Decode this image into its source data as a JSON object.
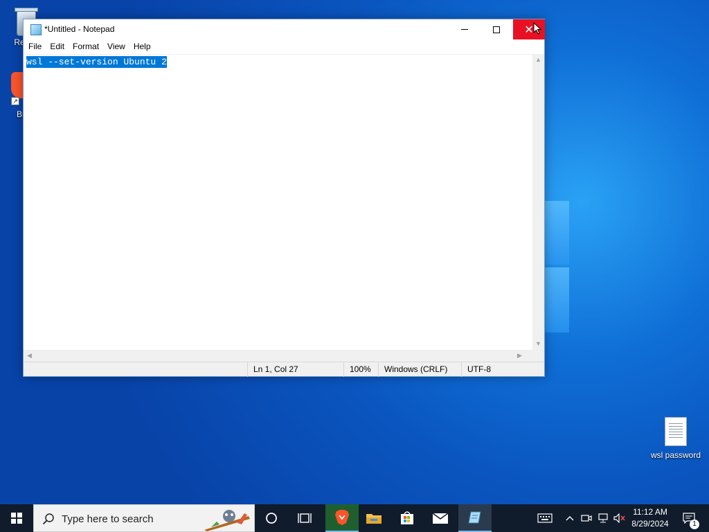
{
  "desktop": {
    "icons": [
      {
        "label": "Recyc"
      },
      {
        "label": "Br"
      },
      {
        "label": "wsl password"
      }
    ]
  },
  "notepad": {
    "title": "*Untitled - Notepad",
    "menu": [
      "File",
      "Edit",
      "Format",
      "View",
      "Help"
    ],
    "content": "wsl --set-version Ubuntu 2",
    "status": {
      "position": "Ln 1, Col 27",
      "zoom": "100%",
      "line_ending": "Windows (CRLF)",
      "encoding": "UTF-8"
    }
  },
  "taskbar": {
    "search_placeholder": "Type here to search",
    "clock_time": "11:12 AM",
    "clock_date": "8/29/2024",
    "notification_count": "1"
  },
  "colors": {
    "close_button": "#e81123",
    "selection": "#0078d7",
    "taskbar": "#101c2c"
  }
}
